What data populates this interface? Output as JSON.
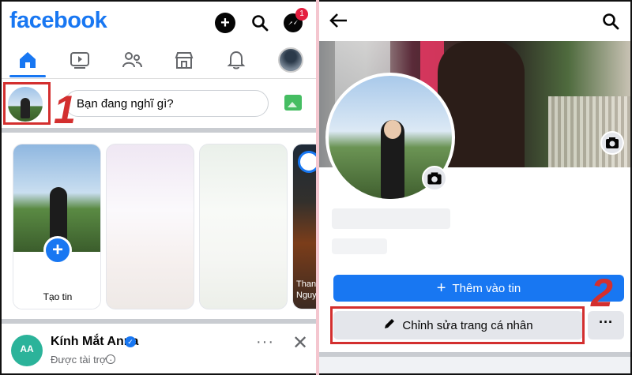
{
  "left": {
    "app_title": "facebook",
    "notification_badge": "1",
    "composer_placeholder": "Bạn đang nghĩ gì?",
    "step_number": "1",
    "create_story_label": "Tạo tin",
    "partial_story_text": "Than Nguy",
    "post": {
      "page_name": "Kính Mắt Anna",
      "sponsored": "Được tài trợ ·",
      "more": "···",
      "close": "✕"
    }
  },
  "right": {
    "add_story_label": "Thêm vào tin",
    "edit_profile_label": "Chỉnh sửa trang cá nhân",
    "more_label": "···",
    "step_number": "2"
  },
  "colors": {
    "brand_blue": "#1877f2",
    "highlight_red": "#d32f2f"
  },
  "icons": [
    "home-icon",
    "video-icon",
    "friends-icon",
    "marketplace-icon",
    "bell-icon",
    "search-icon",
    "messenger-icon",
    "camera-icon",
    "pencil-icon",
    "back-arrow-icon"
  ]
}
